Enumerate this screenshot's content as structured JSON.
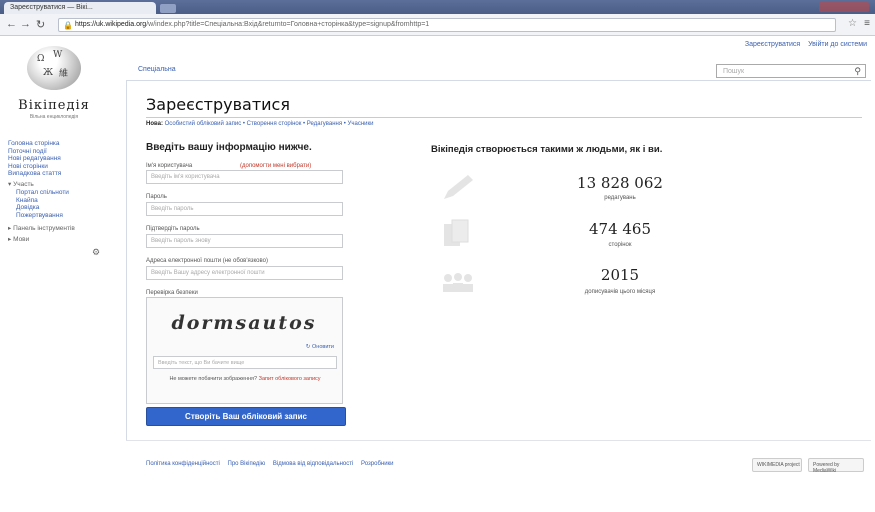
{
  "browser": {
    "tab_title": "Зареєструватися — Вікі...",
    "url_host": "https://uk.wikipedia.org",
    "url_rest": "/w/index.php?title=Спеціальна:Вхід&returnto=Головна+сторінка&type=signup&fromhttp=1"
  },
  "personal": {
    "create_account": "Зареєструватися",
    "login": "Увійти до системи"
  },
  "logo": {
    "title": "Вікіпедія",
    "subtitle": "Вільна енциклопедія"
  },
  "sidebar": {
    "items": [
      "Головна сторінка",
      "Поточні події",
      "Нові редагування",
      "Нові сторінки",
      "Випадкова стаття"
    ],
    "participation": "Участь",
    "participation_items": [
      "Портал спільноти",
      "Кнайпа",
      "Довідка",
      "Пожертвування"
    ],
    "tools": "Панель інструментів",
    "languages": "Мови"
  },
  "tab_special": "Спеціальна",
  "search": {
    "placeholder": "Пошук"
  },
  "page": {
    "title": "Зареєструватися",
    "breadcrumb_prefix": "Нова:",
    "breadcrumb": "Особистий обліковий запис • Створення сторінок • Редагування • Учасники"
  },
  "form": {
    "heading": "Введіть вашу інформацію нижче.",
    "username_label": "Ім'я користувача",
    "username_link": "(допомогти мені вибрати)",
    "username_placeholder": "Введіть ім'я користувача",
    "password_label": "Пароль",
    "password_placeholder": "Введіть пароль",
    "confirm_label": "Підтвердіть пароль",
    "confirm_placeholder": "Введіть пароль знову",
    "email_label": "Адреса електронної пошти (не обов'язково)",
    "email_placeholder": "Введіть Вашу адресу електронної пошти",
    "captcha_label": "Перевірка безпеки",
    "captcha_word": "dormsautos",
    "captcha_refresh": "Оновити",
    "captcha_input_placeholder": "Введіть текст, що Ви бачите вище",
    "captcha_help": "Не можете побачити зображення?",
    "captcha_help_link": "Запит облікового запису",
    "submit": "Створіть Ваш обліковий запис"
  },
  "stats": {
    "heading": "Вікіпедія створюється такими ж людьми, як і ви.",
    "items": [
      {
        "value": "13 828 062",
        "label": "редагувань",
        "icon": "pencil-icon"
      },
      {
        "value": "474 465",
        "label": "сторінок",
        "icon": "pages-icon"
      },
      {
        "value": "2015",
        "label": "дописувачів цього місяця",
        "icon": "users-icon"
      }
    ]
  },
  "footer": {
    "links": [
      "Політика конфіденційності",
      "Про Вікіпедію",
      "Відмова від відповідальності",
      "Розробники"
    ],
    "badge_left": "WIKIMEDIA project",
    "badge_right": "Powered by MediaWiki"
  }
}
